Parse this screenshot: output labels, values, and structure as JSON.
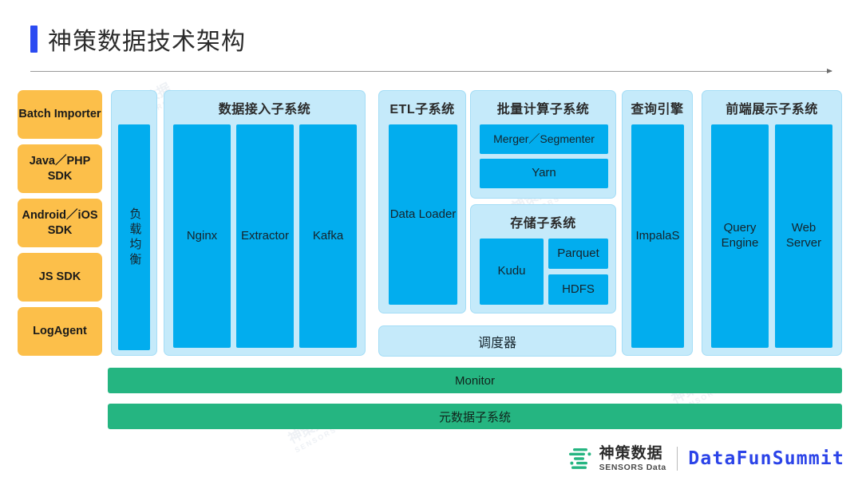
{
  "header": {
    "title": "神策数据技术架构",
    "accent_color": "#2B4BF2"
  },
  "colors": {
    "source_box": "#FCBF4A",
    "node": "#02ADEE",
    "group_bg": "#C5EAFA",
    "bar": "#25B581",
    "brand_blue": "#2B43E8",
    "brand_green": "#25B581"
  },
  "sources": {
    "items": [
      {
        "label": "Batch Importer"
      },
      {
        "label": "Java／PHP SDK"
      },
      {
        "label": "Android／iOS SDK"
      },
      {
        "label": "JS SDK"
      },
      {
        "label": "LogAgent"
      }
    ]
  },
  "load_balancer": {
    "label": "负载均衡"
  },
  "ingest": {
    "title": "数据接入子系统",
    "nodes": [
      {
        "label": "Nginx"
      },
      {
        "label": "Extractor"
      },
      {
        "label": "Kafka"
      }
    ]
  },
  "etl": {
    "title": "ETL子系统",
    "nodes": [
      {
        "label": "Data Loader"
      }
    ]
  },
  "batch": {
    "title": "批量计算子系统",
    "nodes": [
      {
        "label": "Merger／Segmenter"
      },
      {
        "label": "Yarn"
      }
    ]
  },
  "storage": {
    "title": "存储子系统",
    "nodes": [
      {
        "label": "Kudu"
      },
      {
        "label": "Parquet"
      },
      {
        "label": "HDFS"
      }
    ]
  },
  "scheduler": {
    "label": "调度器"
  },
  "query": {
    "title": "查询引擎",
    "nodes": [
      {
        "label": "ImpalaS"
      }
    ]
  },
  "frontend": {
    "title": "前端展示子系统",
    "nodes": [
      {
        "label": "Query Engine"
      },
      {
        "label": "Web Server"
      }
    ]
  },
  "bars": [
    {
      "label": "Monitor"
    },
    {
      "label": "元数据子系统"
    }
  ],
  "footer": {
    "sensors_cn": "神策数据",
    "sensors_en": "SENSORS Data",
    "event": "DataFunSummit"
  },
  "watermark": {
    "cn": "神策数据",
    "en": "SENSORS Data"
  }
}
